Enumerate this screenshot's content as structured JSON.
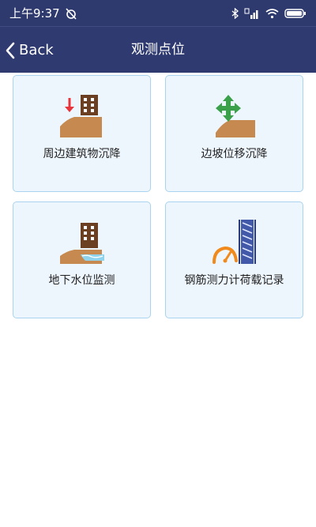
{
  "status_bar": {
    "time": "上午9:37",
    "icons": [
      "alarm-off-icon",
      "bluetooth-icon",
      "signal-icon",
      "wifi-icon",
      "battery-icon"
    ]
  },
  "nav": {
    "back_label": "Back",
    "title": "观测点位"
  },
  "cards": [
    {
      "label": "周边建筑物沉降",
      "icon": "building-settlement-icon"
    },
    {
      "label": "边坡位移沉降",
      "icon": "slope-displacement-icon"
    },
    {
      "label": "地下水位监测",
      "icon": "groundwater-level-icon"
    },
    {
      "label": "钢筋测力计荷载记录",
      "icon": "rebar-load-icon"
    }
  ],
  "colors": {
    "nav_bg": "#2f3b70",
    "card_bg": "#eef6fd",
    "card_border": "#a9d3ee",
    "soil": "#c6894f",
    "building": "#6b3f22",
    "arrow_red": "#e8343a",
    "arrow_green": "#3aa04a",
    "water": "#8fd4ec",
    "steel": "#4258a8",
    "gauge": "#f08a1c"
  }
}
